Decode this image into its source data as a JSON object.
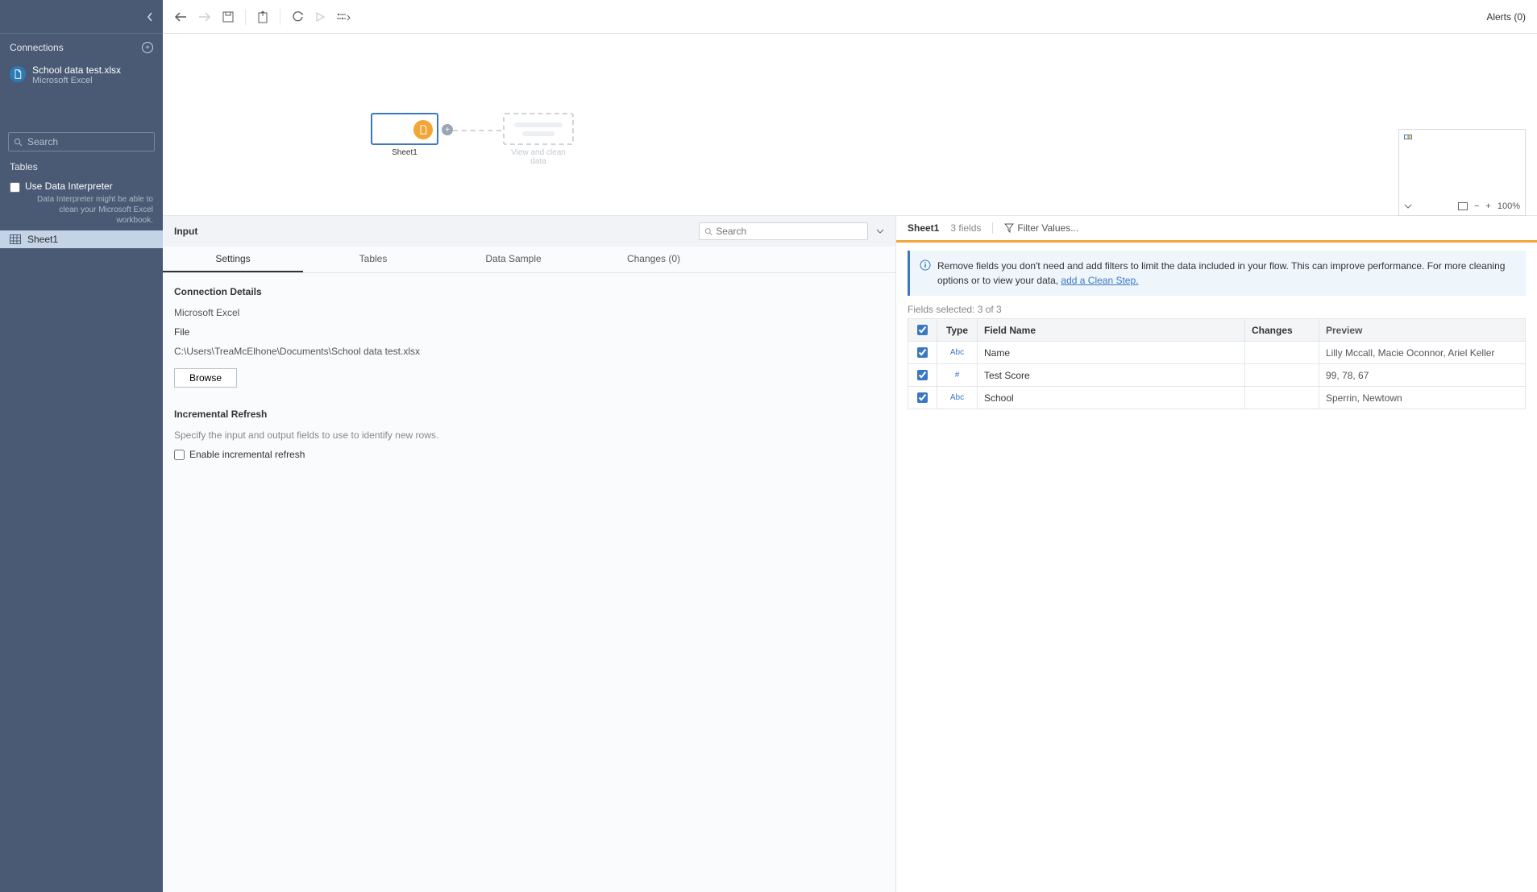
{
  "sidebar": {
    "connections_label": "Connections",
    "connection": {
      "name": "School data test.xlsx",
      "type": "Microsoft Excel"
    },
    "search_placeholder": "Search",
    "tables_label": "Tables",
    "interpreter_label": "Use Data Interpreter",
    "interpreter_desc": "Data Interpreter might be able to clean your Microsoft Excel workbook.",
    "table_item": "Sheet1"
  },
  "toolbar": {
    "alerts": "Alerts (0)"
  },
  "canvas": {
    "node_label": "Sheet1",
    "drop_label": "View and clean data",
    "zoom": "100%"
  },
  "left": {
    "input_label": "Input",
    "search_placeholder": "Search",
    "tabs": {
      "settings": "Settings",
      "tables": "Tables",
      "data_sample": "Data Sample",
      "changes": "Changes (0)"
    },
    "settings": {
      "connection_details": "Connection Details",
      "source_type": "Microsoft Excel",
      "file_label": "File",
      "file_path": "C:\\Users\\TreaMcElhone\\Documents\\School data test.xlsx",
      "browse": "Browse",
      "inc_title": "Incremental Refresh",
      "inc_desc": "Specify the input and output fields to use to identify new rows.",
      "inc_check": "Enable incremental refresh"
    }
  },
  "right": {
    "sheet_name": "Sheet1",
    "fields_meta_top": "3 fields",
    "filter_label": "Filter Values...",
    "banner_text": "Remove fields you don't need and add filters to limit the data included in your flow. This can improve performance. For more cleaning options or to view your data, ",
    "banner_link": "add a Clean Step.",
    "fields_selected": "Fields selected: 3 of 3",
    "headers": {
      "type": "Type",
      "field_name": "Field Name",
      "changes": "Changes",
      "preview": "Preview"
    },
    "rows": [
      {
        "type": "Abc",
        "name": "Name",
        "preview": "Lilly Mccall, Macie Oconnor, Ariel Keller"
      },
      {
        "type": "#",
        "name": "Test Score",
        "preview": "99, 78, 67"
      },
      {
        "type": "Abc",
        "name": "School",
        "preview": "Sperrin, Newtown"
      }
    ]
  }
}
